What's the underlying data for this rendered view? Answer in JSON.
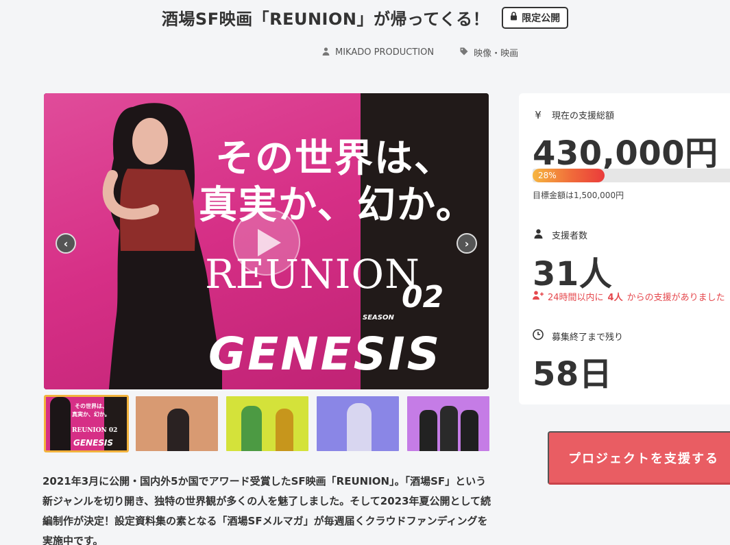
{
  "header": {
    "title": "酒場SF映画「REUNION」が帰ってくる！",
    "badge": "限定公開",
    "owner": "MIKADO PRODUCTION",
    "category": "映像・映画"
  },
  "hero": {
    "line1": "その世界は、",
    "line2": "真実か、幻か。",
    "logo_reunion": "REUNION",
    "season_label": "SEASON",
    "season_number": "02",
    "logo_genesis": "GENESIS"
  },
  "thumbnails": [
    {
      "caption1": "その世界は、",
      "caption2": "真実か、幻か。",
      "caption3": "REUNION 02",
      "caption4": "GENESIS"
    },
    {},
    {},
    {},
    {}
  ],
  "description": "2021年3月に公開・国内外5か国でアワード受賞したSF映画「REUNION」。「酒場SF」という新ジャンルを切り開き、独特の世界観が多くの人を魅了しました。そして2023年夏公開として続編制作が決定！設定資料集の素となる「酒場SFメルマガ」が毎週届くクラウドファンディングを実施中です。",
  "stats": {
    "currency_icon": "yen-icon",
    "total_label": "現在の支援総額",
    "total_amount": "430,000円",
    "progress_percent": 28,
    "progress_label": "28%",
    "goal_text": "目標金額は1,500,000円",
    "supporters_label": "支援者数",
    "supporters_count": "31人",
    "recent_prefix": "24時間以内に",
    "recent_count": "4人",
    "recent_suffix": "からの支援がありました",
    "remaining_label": "募集終了まで残り",
    "remaining_days": "58日"
  },
  "cta": {
    "support_label": "プロジェクトを支援する"
  },
  "colors": {
    "accent": "#e95d63",
    "alert": "#e5484d",
    "active_thumb_border": "#f2b33d"
  }
}
